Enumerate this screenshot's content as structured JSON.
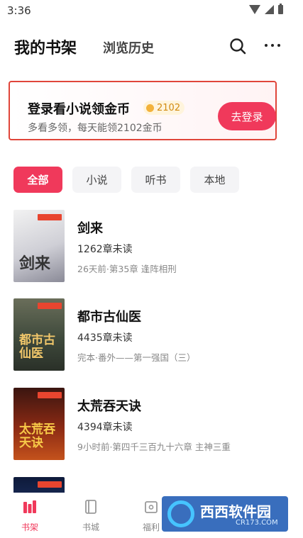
{
  "status_bar": {
    "time": "3:36"
  },
  "header": {
    "tabs": [
      {
        "label": "我的书架"
      },
      {
        "label": "浏览历史"
      }
    ],
    "icons": [
      "search-icon",
      "more-icon"
    ]
  },
  "login_card": {
    "title": "登录看小说领金币",
    "coins": "2102",
    "subtitle": "多看多领，每天能领2102金币",
    "button_label": "去登录",
    "accent_color": "#f0395b"
  },
  "filters": [
    {
      "label": "全部"
    },
    {
      "label": "小说"
    },
    {
      "label": "听书"
    },
    {
      "label": "本地"
    }
  ],
  "books": [
    {
      "title": "剑来",
      "unread": "1262章未读",
      "progress": "26天前·第35章 逢阵相刑",
      "cover_text": "剑来"
    },
    {
      "title": "都市古仙医",
      "unread": "4435章未读",
      "progress": "完本·番外——第一强国（三）",
      "cover_text": "都市古仙医"
    },
    {
      "title": "太荒吞天诀",
      "unread": "4394章未读",
      "progress": "9小时前·第四千三百九十六章 主神三重",
      "cover_text": "太荒吞天诀"
    }
  ],
  "bottom_nav": [
    {
      "label": "书架"
    },
    {
      "label": "书城"
    },
    {
      "label": "福利"
    }
  ],
  "watermark": {
    "text": "西西软件园",
    "site": "CR173.COM"
  }
}
